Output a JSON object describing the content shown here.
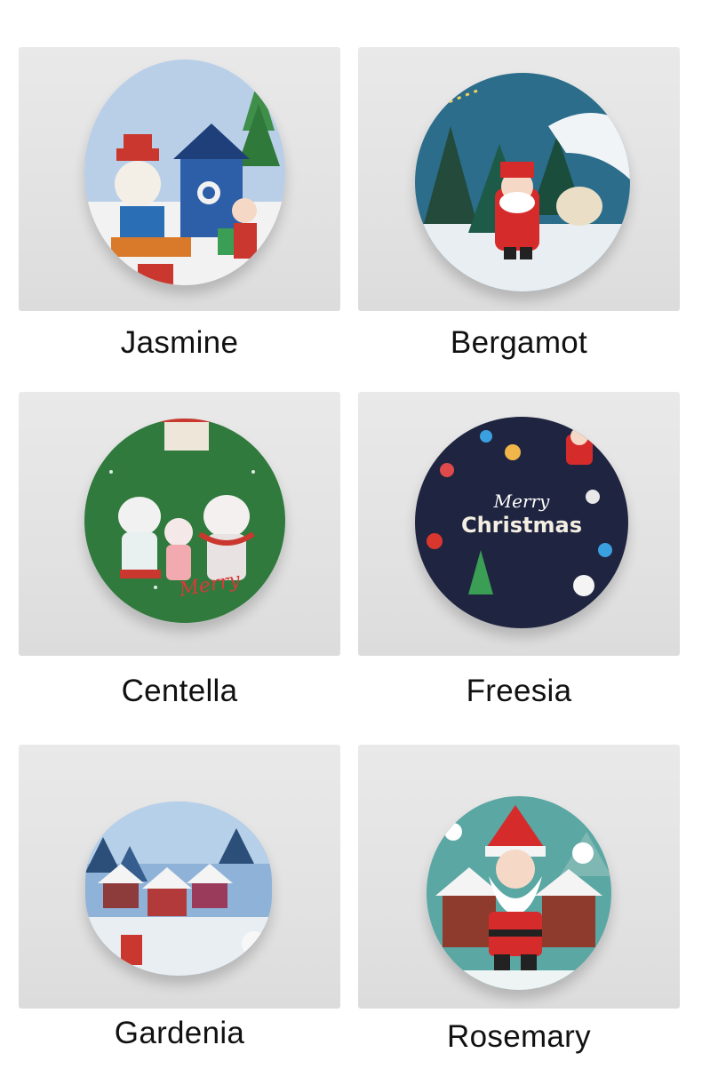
{
  "products": [
    {
      "name": "Jasmine"
    },
    {
      "name": "Bergamot"
    },
    {
      "name": "Centella"
    },
    {
      "name": "Freesia"
    },
    {
      "name": "Gardenia"
    },
    {
      "name": "Rosemary"
    }
  ],
  "tin_text": {
    "freesia_line1": "Merry",
    "freesia_line2": "Christmas",
    "centella_script": "Merry"
  }
}
